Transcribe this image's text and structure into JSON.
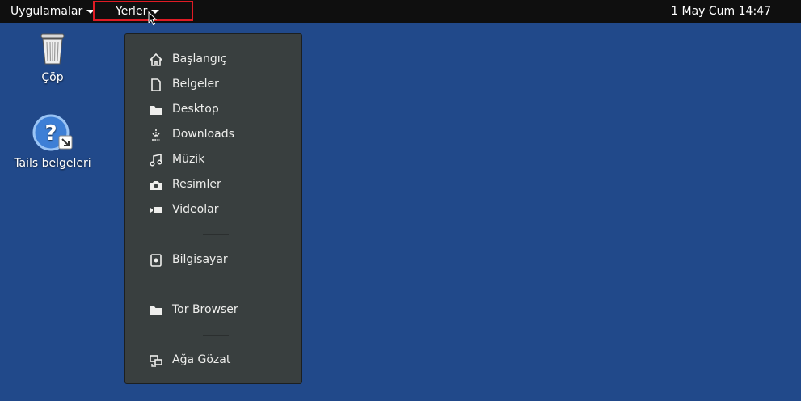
{
  "topbar": {
    "applications_label": "Uygulamalar",
    "places_label": "Yerler",
    "clock": "1 May Cum  14:47"
  },
  "desktop": {
    "icons": [
      {
        "label": "Çöp",
        "icon": "trash-icon"
      },
      {
        "label": "Tails belgeleri",
        "icon": "help-icon"
      }
    ]
  },
  "places_menu": {
    "items": [
      {
        "label": "Başlangıç",
        "icon": "home-icon"
      },
      {
        "label": "Belgeler",
        "icon": "document-icon"
      },
      {
        "label": "Desktop",
        "icon": "folder-icon"
      },
      {
        "label": "Downloads",
        "icon": "download-icon"
      },
      {
        "label": "Müzik",
        "icon": "music-icon"
      },
      {
        "label": "Resimler",
        "icon": "camera-icon"
      },
      {
        "label": "Videolar",
        "icon": "video-icon"
      },
      {
        "label": "Bilgisayar",
        "icon": "drive-icon"
      },
      {
        "label": "Tor Browser",
        "icon": "folder-icon"
      },
      {
        "label": "Ağa Gözat",
        "icon": "network-icon"
      }
    ]
  },
  "colors": {
    "desktop_background": "#21498a",
    "topbar": "#0f0f0f",
    "menu_background": "#393f3f",
    "highlight_border": "#e01b24"
  }
}
